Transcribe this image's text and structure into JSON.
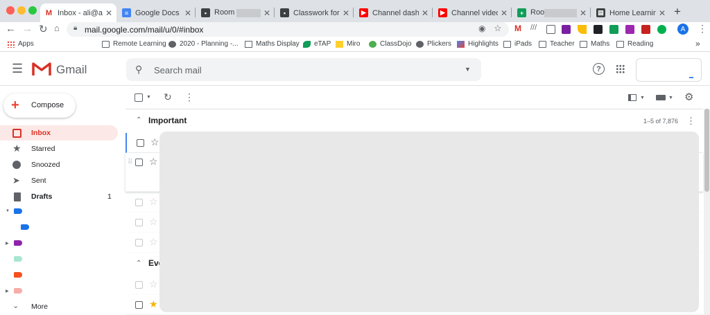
{
  "browser": {
    "tabs": [
      {
        "title": "Inbox - ali@araku",
        "active": true,
        "icon": "gmail-icon",
        "color": "#d93025"
      },
      {
        "title": "Google Docs",
        "icon": "docs-icon",
        "color": "#4285f4"
      },
      {
        "title": "Room",
        "icon": "classroom-icon",
        "color": "#3c4043",
        "redacted": true
      },
      {
        "title": "Classwork for Ro",
        "icon": "classroom-icon",
        "color": "#3c4043"
      },
      {
        "title": "Channel dashboa",
        "icon": "youtube-icon",
        "color": "#ff0000"
      },
      {
        "title": "Channel videos -",
        "icon": "youtube-icon",
        "color": "#ff0000"
      },
      {
        "title": "Roo",
        "icon": "sheets-icon",
        "color": "#0f9d58",
        "redacted": true
      },
      {
        "title": "Home Learning T",
        "icon": "film-icon",
        "color": "#3c4043"
      }
    ],
    "new_tab": "+",
    "url": "mail.google.com/mail/u/0/#inbox",
    "profile_initial": "A"
  },
  "bookmarks": {
    "apps_label": "Apps",
    "items": [
      {
        "label": "Remote Learning",
        "icon": "folder-icon"
      },
      {
        "label": "2020 - Planning -...",
        "icon": "globe-icon"
      },
      {
        "label": "Maths Display",
        "icon": "grid-icon"
      },
      {
        "label": "eTAP",
        "icon": "etap-icon"
      },
      {
        "label": "Miro",
        "icon": "miro-icon"
      },
      {
        "label": "ClassDojo",
        "icon": "classdojo-icon"
      },
      {
        "label": "Plickers",
        "icon": "globe-icon"
      },
      {
        "label": "Highlights",
        "icon": "highlights-icon"
      },
      {
        "label": "iPads",
        "icon": "folder-icon"
      },
      {
        "label": "Teacher",
        "icon": "folder-icon"
      },
      {
        "label": "Maths",
        "icon": "folder-icon"
      },
      {
        "label": "Reading",
        "icon": "folder-icon"
      }
    ],
    "more": "»"
  },
  "gmail": {
    "logo_text": "Gmail",
    "search_placeholder": "Search mail",
    "compose_label": "Compose",
    "nav": [
      {
        "label": "Inbox",
        "active": true,
        "bold": true,
        "icon": "inbox-icon"
      },
      {
        "label": "Starred",
        "icon": "star-icon"
      },
      {
        "label": "Snoozed",
        "icon": "clock-icon"
      },
      {
        "label": "Sent",
        "icon": "send-icon"
      },
      {
        "label": "Drafts",
        "bold": true,
        "count": "1",
        "icon": "draft-icon"
      }
    ],
    "labels": [
      {
        "color": "#1a73e8",
        "caret": "down"
      },
      {
        "color": "#1a73e8",
        "indent": true
      },
      {
        "color": "#8e24aa",
        "caret": "right"
      },
      {
        "color": "#a8e6cf"
      },
      {
        "color": "#f4511e"
      },
      {
        "color": "#f6aea9",
        "caret": "right"
      }
    ],
    "more_label": "More",
    "sections": [
      {
        "title": "Important",
        "range": "1–5 of 7,876"
      },
      {
        "title": "Eve"
      }
    ],
    "accent_red": "#d93025"
  }
}
